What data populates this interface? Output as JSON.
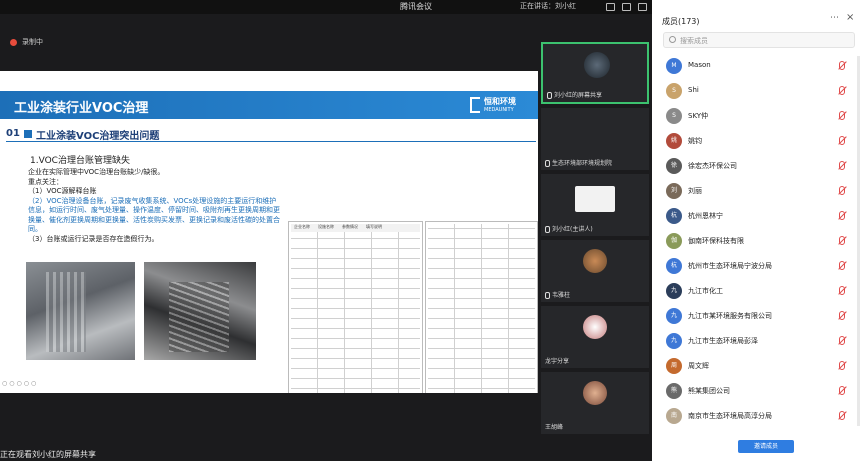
{
  "topbar": {
    "meeting_title": "腾讯会议",
    "speaking": "正在讲话：刘小红"
  },
  "recording": {
    "label": "录制中"
  },
  "slide": {
    "banner_title": "工业涂装行业VOC治理",
    "logo_cn": "恒和环境",
    "logo_en": "MEDAUNITY",
    "section_number": "01",
    "section_title": "工业涂装VOC治理突出问题",
    "subheading": "1.VOC治理台账管理缺失",
    "body": [
      "企业在实际管理中VOC治理台账缺少/缺很。",
      "重点关注：",
      "（1）VOC源解释台账",
      "（2）VOC治理设备台账，记录废气收集系统、VOCs处理设施的主要运行和维护信息，如运行时间、废气处理量、操作温度、停留时间、吸附剂再生更换周期和更换量、催化剂更换周期和更换量、活性炭购买发票、更换记录和废活性碳的处置合同。",
      "（3）台账或运行记录是否存在造假行为。"
    ],
    "table_headers": [
      "企业名称",
      "设施名称",
      "参数情况",
      "填写说明"
    ]
  },
  "caption": "正在观看刘小红的屏幕共享",
  "videos": [
    {
      "name": "刘小红的屏幕共享"
    },
    {
      "name": "生态环境部环境规划院"
    },
    {
      "name": "刘小红(主讲人)"
    },
    {
      "name": "韦雅柱"
    },
    {
      "name": "龙宇分享"
    },
    {
      "name": "王胡峰"
    }
  ],
  "panel": {
    "title": "成员(173)",
    "search_placeholder": "搜索成员",
    "members": [
      {
        "name": "Mason",
        "initial": "M",
        "color": "#3f78d6"
      },
      {
        "name": "Shi",
        "initial": "S",
        "color": "#c9a36b"
      },
      {
        "name": "SKY仲",
        "initial": "S",
        "color": "#8a8a8a"
      },
      {
        "name": "姚钧",
        "initial": "姚",
        "color": "#b24b3b"
      },
      {
        "name": "徐宏杰环保公司",
        "initial": "徐",
        "color": "#5a5a5a"
      },
      {
        "name": "刘丽",
        "initial": "刘",
        "color": "#7a6a5a"
      },
      {
        "name": "杭州恩林宁",
        "initial": "杭",
        "color": "#3b5a8a"
      },
      {
        "name": "伽南环保科技有限",
        "initial": "伽",
        "color": "#8a9a5a"
      },
      {
        "name": "杭州市生态环境局宁波分局",
        "initial": "杭",
        "color": "#3f78d6"
      },
      {
        "name": "九江市化工",
        "initial": "九",
        "color": "#2b3d5a"
      },
      {
        "name": "九江市某环境服务有限公司",
        "initial": "九",
        "color": "#3f78d6"
      },
      {
        "name": "九江市生态环境局彭泽",
        "initial": "九",
        "color": "#3f78d6"
      },
      {
        "name": "周文辉",
        "initial": "周",
        "color": "#c46a2e"
      },
      {
        "name": "熊某集团公司",
        "initial": "熊",
        "color": "#6a6a6a"
      },
      {
        "name": "南京市生态环境局高淳分局",
        "initial": "南",
        "color": "#b8a890"
      }
    ],
    "invite_label": "邀请成员"
  },
  "colors": {
    "accent": "#1d6fb8",
    "active_speaker": "#3cc26f",
    "muted": "#e04b4b"
  }
}
